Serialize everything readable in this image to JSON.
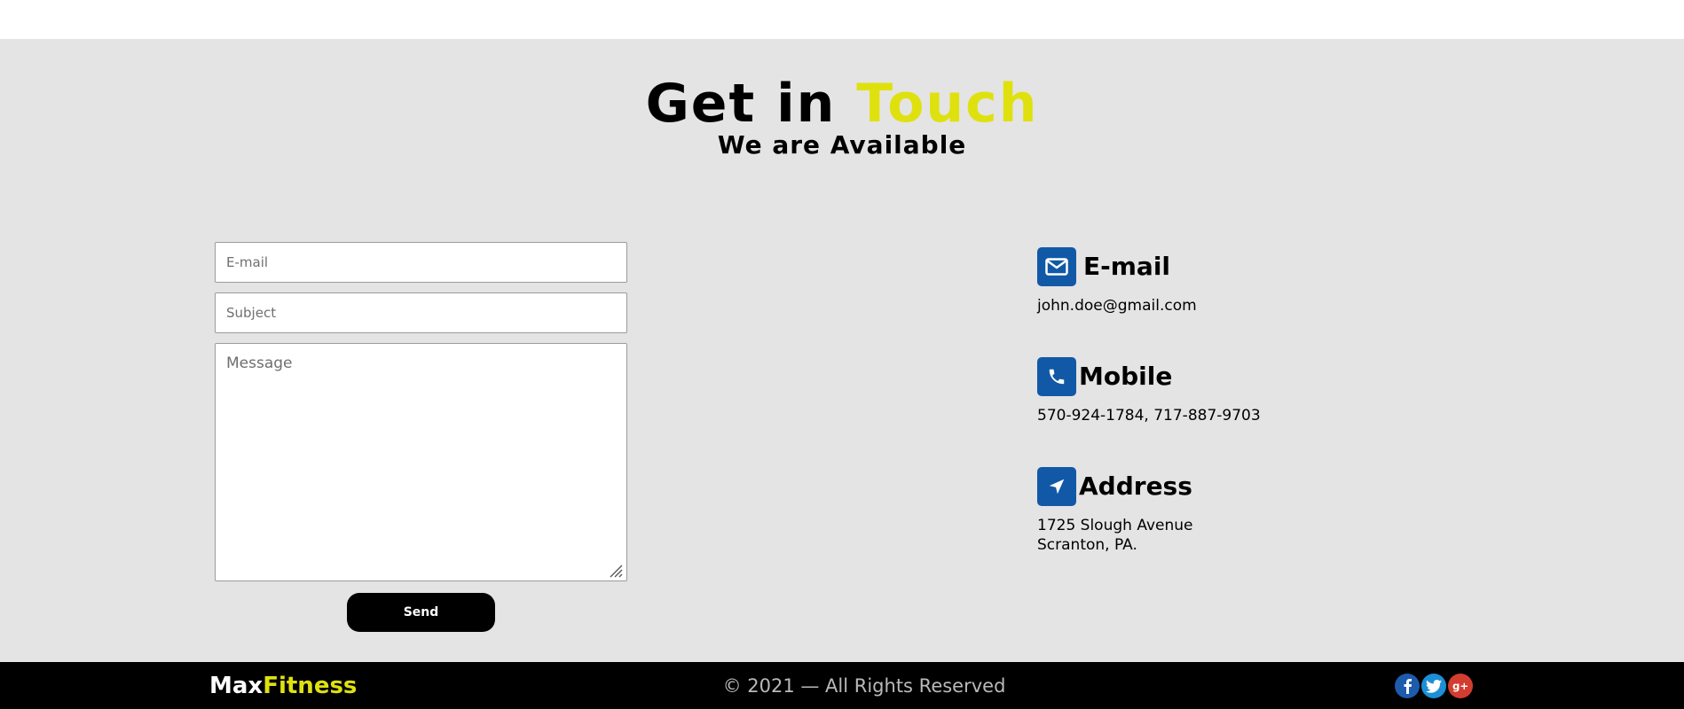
{
  "header": {
    "title_part1": "Get in",
    "title_part2": "Touch",
    "subtitle": "We are Available"
  },
  "form": {
    "email_placeholder": "E-mail",
    "subject_placeholder": "Subject",
    "message_placeholder": "Message",
    "send_label": "Send"
  },
  "contact": {
    "email": {
      "title": "E-mail",
      "value": "john.doe@gmail.com",
      "icon": "envelope-icon"
    },
    "mobile": {
      "title": "Mobile",
      "value": "570-924-1784, 717-887-9703",
      "icon": "phone-icon"
    },
    "address": {
      "title": "Address",
      "line1": "1725 Slough Avenue",
      "line2": "Scranton, PA.",
      "icon": "location-arrow-icon"
    }
  },
  "footer": {
    "brand_part1": "Max",
    "brand_part2": "Fitness",
    "copyright": "© 2021 — All Rights Reserved",
    "social": [
      {
        "name": "facebook-icon",
        "glyph": "f",
        "color": "#1d5bad"
      },
      {
        "name": "twitter-icon",
        "glyph": "t",
        "color": "#1c8fd6"
      },
      {
        "name": "google-plus-icon",
        "glyph": "g+",
        "color": "#d23d2f"
      }
    ]
  },
  "colors": {
    "accent": "#dfe10f",
    "icon_bg": "#1159a6",
    "section_bg": "#e4e4e4",
    "footer_bg": "#000000"
  }
}
